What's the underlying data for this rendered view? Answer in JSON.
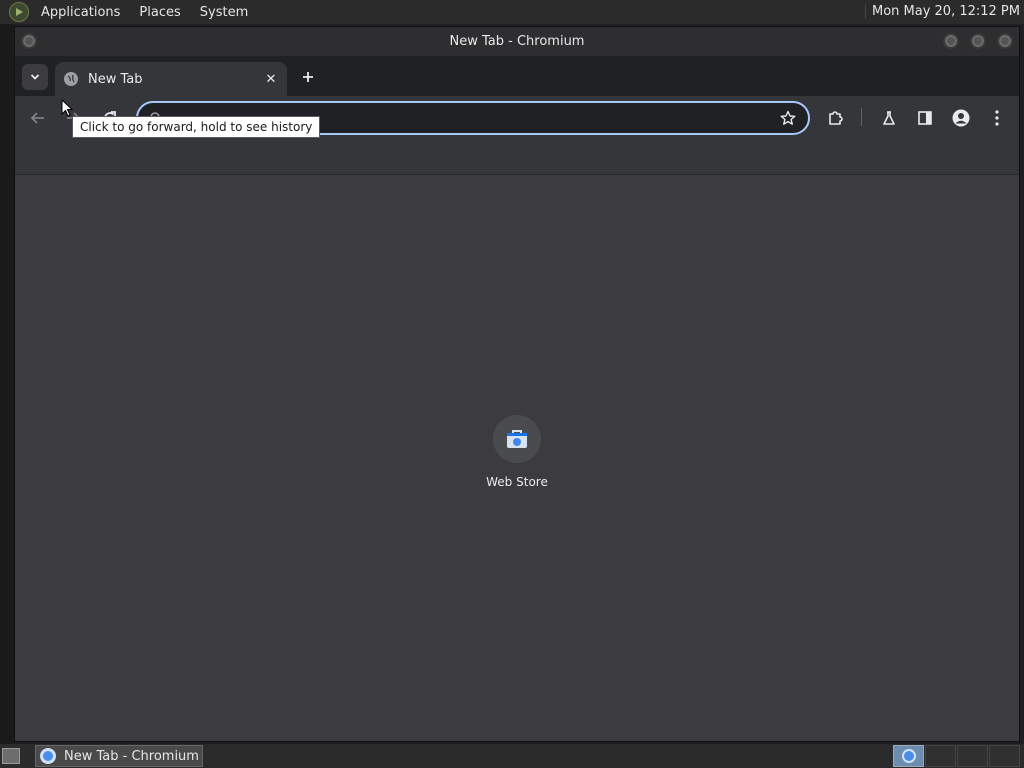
{
  "top_panel": {
    "menus": [
      "Applications",
      "Places",
      "System"
    ],
    "clock": "Mon May 20, 12:12 PM"
  },
  "window": {
    "title": "New Tab - Chromium"
  },
  "tabs": [
    {
      "title": "New Tab",
      "active": true
    }
  ],
  "toolbar": {
    "omnibox_value": "",
    "tooltip": "Click to go forward, hold to see history"
  },
  "content": {
    "shortcuts": [
      {
        "label": "Web Store"
      }
    ]
  },
  "taskbar": {
    "items": [
      {
        "label": "New Tab - Chromium"
      }
    ]
  },
  "colors": {
    "accent": "#a8c7fa",
    "content_bg": "#3c3c40",
    "toolbar_bg": "#35363a",
    "tabstrip_bg": "#202124"
  }
}
